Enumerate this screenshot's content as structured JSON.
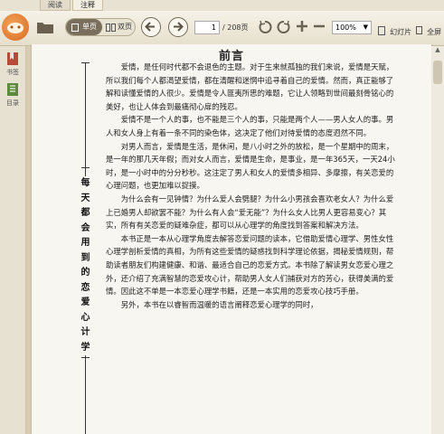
{
  "tabs": [
    {
      "label": "阅读"
    },
    {
      "label": "注释"
    }
  ],
  "toolbar": {
    "view_single": "单页",
    "view_double": "双页",
    "current_page": "1",
    "total_pages": "/ 208页",
    "zoom": "100%",
    "slideshow": "幻灯片",
    "fullscreen": "全屏"
  },
  "sidebar": {
    "items": [
      {
        "label": "书签",
        "icon": "bookmark-icon"
      },
      {
        "label": "目录",
        "icon": "toc-icon"
      }
    ]
  },
  "document": {
    "title": "前言",
    "vertical_title": [
      "每",
      "天",
      "都",
      "会",
      "用",
      "到",
      "的",
      "恋",
      "爱",
      "心",
      "计",
      "学"
    ],
    "paragraphs": [
      "爱情，是任何时代都不会退色的主题。对于生来就孤独的我们来说，爱情是天赋，所以我们每个人都渴望爱情，都在清醒和迷惘中追寻着自己的爱情。然而，真正能够了解和读懂爱情的人很少。爱情是令人匪夷所思的难题，它让人领略到世间最刻骨铭心的美好，也让人体会到最痛彻心扉的残忍。",
      "爱情不是一个人的事，也不能是三个人的事，只能是两个人——男人女人的事。男人和女人身上有着一条不同的染色体，这决定了他们对待爱情的态度迥然不同。",
      "对男人而言，爱情是生活，是休闲，是八小时之外的放松，是一个星期中的周末，是一年的那几天年假；而对女人而言，爱情是生命，是事业，是一年365天，一天24小时，是一小时中的分分秒秒。这注定了男人和女人的爱情多相异、多摩擦，有关恋爱的心理问题，也更加难以捉摸。",
      "为什么会有一见钟情？为什么爱人会劈腿？为什么小男孩会喜欢老女人？为什么爱上已婚男人却欲罢不能？为什么有人会“爱无能”？为什么女人比男人更容易变心？其实，所有有关恋爱的疑难杂症，都可以从心理学的角度找到答案和解决方法。",
      "本书正是一本从心理学角度去解答恋爱问题的读本，它借助爱情心理学、男性女性心理学剖析爱情的真相，为所有这些爱情的疑惑找到科学理论依据，揭秘爱情规则，帮助读者朋友们构建健康、和谐、最适合自己的恋爱方式。本书除了解读男女恋爱心理之外，还介绍了充满智慧的恋爱攻心计，帮助男人女人们捕获对方的芳心，获得美满的爱情。因此这不单是一本恋爱心理学书籍，还是一本实用的恋爱攻心技巧手册。",
      "另外，本书在以睿智而温暖的语言阐释恋爱心理学的同时，"
    ]
  },
  "colors": {
    "toolbar_bg": "#ece6d6",
    "page_bg": "#f8f6f0",
    "accent_orange": "#e07a2e",
    "sidebar_red": "#b84a3a",
    "sidebar_green": "#5a8a3a"
  }
}
